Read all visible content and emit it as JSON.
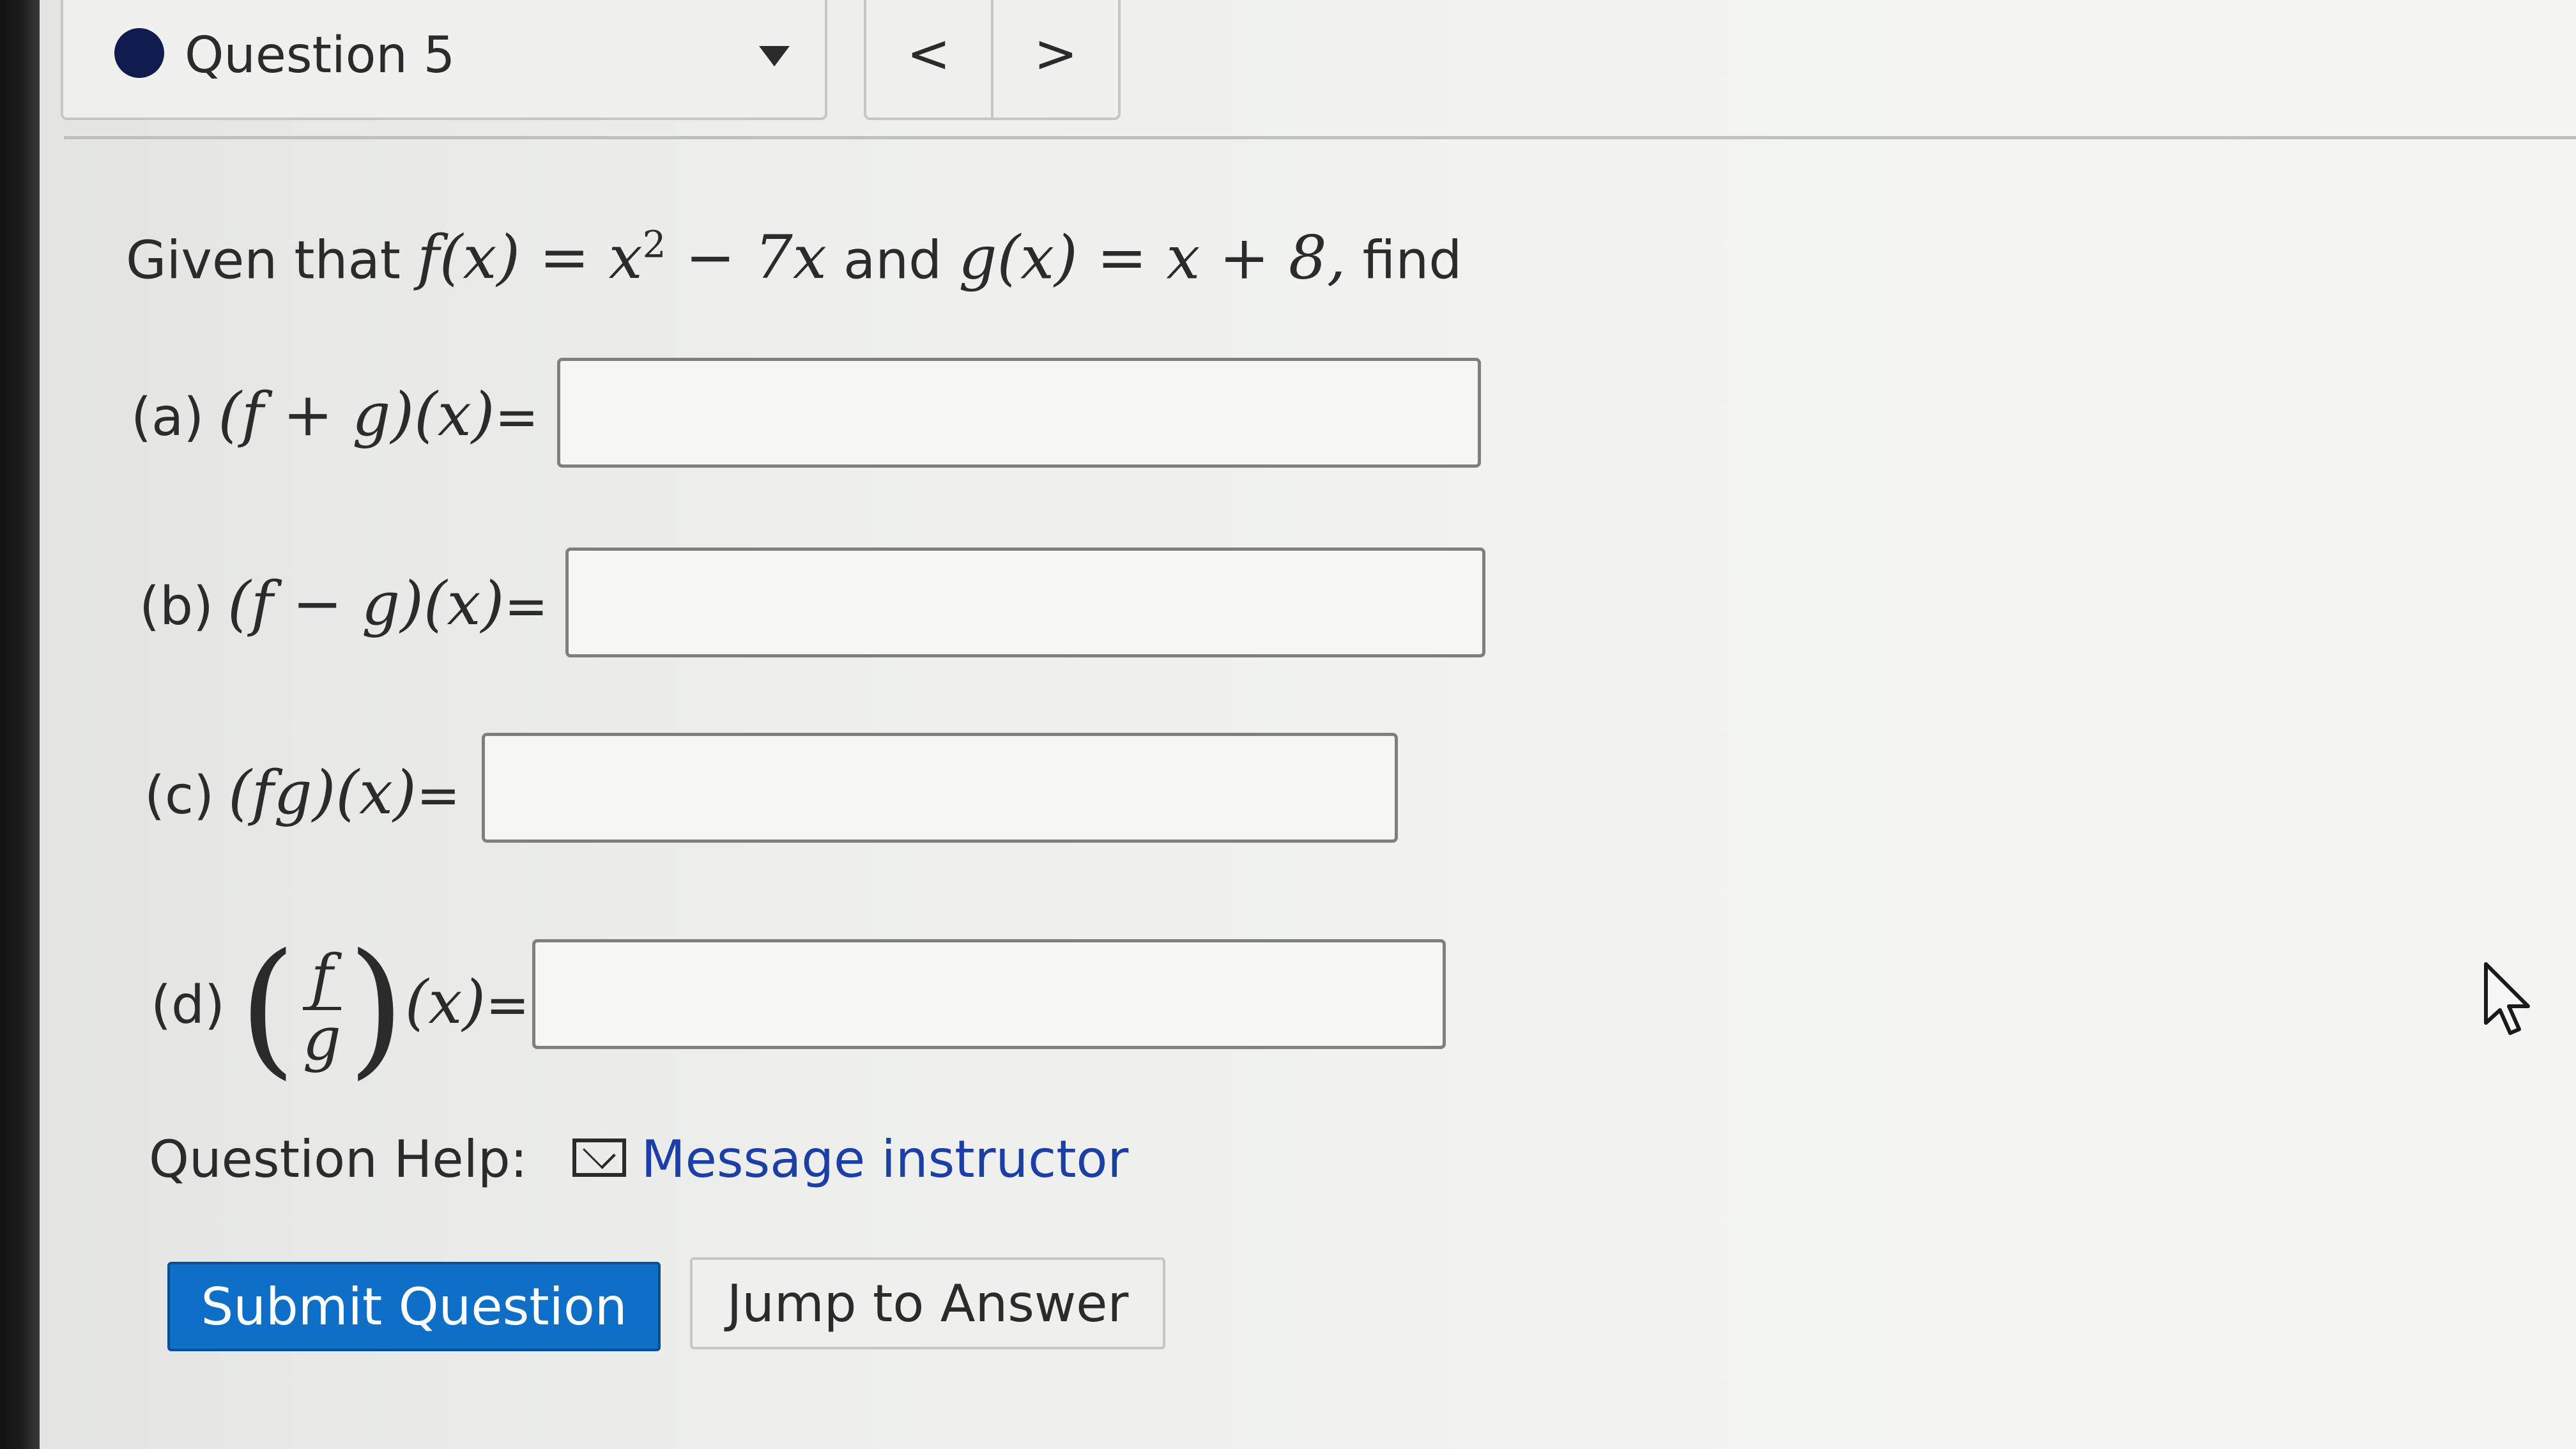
{
  "question_selector": {
    "label": "Question 5"
  },
  "nav": {
    "prev": "<",
    "next": ">"
  },
  "statement": {
    "prefix": "Given that",
    "f_def": "f(x) = x",
    "f_exp": "2",
    "f_rest": " − 7x",
    "and": "and",
    "g_def": "g(x) = x + 8,",
    "suffix": "find"
  },
  "parts": [
    {
      "label": "(a)",
      "expr": "(f + g)(x)",
      "eq": "=",
      "value": ""
    },
    {
      "label": "(b)",
      "expr": "(f − g)(x)",
      "eq": "=",
      "value": ""
    },
    {
      "label": "(c)",
      "expr": "(fg)(x)",
      "eq": "=",
      "value": ""
    },
    {
      "label": "(d)",
      "num": "f",
      "den": "g",
      "expr": "(x)",
      "eq": "=",
      "value": ""
    }
  ],
  "help": {
    "label": "Question Help:",
    "link": "Message instructor",
    "icon": "mail-icon"
  },
  "buttons": {
    "submit": "Submit Question",
    "jump": "Jump to Answer"
  },
  "colors": {
    "submit_bg": "#0f6fc7",
    "link": "#1b3fa6",
    "dot": "#0f1c4d"
  }
}
